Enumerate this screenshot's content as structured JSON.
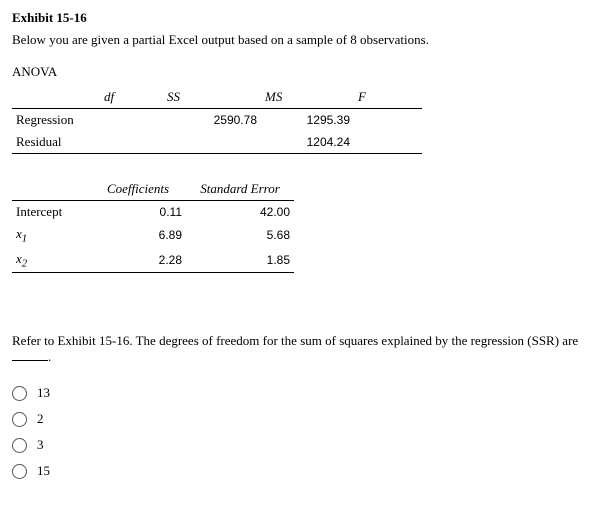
{
  "exhibit_title": "Exhibit 15-16",
  "intro": "Below you are given a partial Excel output based on a sample of 8 observations.",
  "anova": {
    "title": "ANOVA",
    "headers": {
      "df": "df",
      "ss": "SS",
      "ms": "MS",
      "f": "F"
    },
    "rows": [
      {
        "label": "Regression",
        "df": "",
        "ss": "2590.78",
        "ms": "1295.39",
        "f": ""
      },
      {
        "label": "Residual",
        "df": "",
        "ss": "",
        "ms": "1204.24",
        "f": ""
      }
    ]
  },
  "coef": {
    "headers": {
      "coef": "Coefficients",
      "se": "Standard Error"
    },
    "rows": [
      {
        "label_html": "Intercept",
        "coef": "0.11",
        "se": "42.00"
      },
      {
        "label_html": "x1",
        "coef": "6.89",
        "se": "5.68"
      },
      {
        "label_html": "x2",
        "coef": "2.28",
        "se": "1.85"
      }
    ]
  },
  "question": "Refer to Exhibit 15-16. The degrees of freedom for the sum of squares explained by the regression (SSR) are ",
  "options": [
    "13",
    "2",
    "3",
    "15"
  ]
}
